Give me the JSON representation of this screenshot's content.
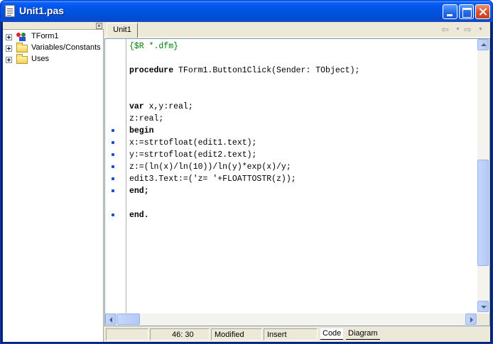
{
  "window": {
    "title": "Unit1.pas"
  },
  "tree": {
    "items": [
      {
        "label": "TForm1",
        "icon": "component-icon"
      },
      {
        "label": "Variables/Constants",
        "icon": "folder-icon"
      },
      {
        "label": "Uses",
        "icon": "folder-icon"
      }
    ],
    "close_label": "×"
  },
  "editor": {
    "tabs": [
      {
        "label": "Unit1"
      }
    ],
    "code_lines": [
      {
        "text": "{$R *.dfm}",
        "style": "comment",
        "dot": false
      },
      {
        "text": "",
        "style": "",
        "dot": false
      },
      {
        "text": "procedure TForm1.Button1Click(Sender: TObject);",
        "style": "",
        "dot": false,
        "keyword": "procedure"
      },
      {
        "text": "",
        "style": "",
        "dot": false
      },
      {
        "text": "",
        "style": "",
        "dot": false
      },
      {
        "text": "var x,y:real;",
        "style": "",
        "dot": false,
        "keyword": "var"
      },
      {
        "text": "z:real;",
        "style": "",
        "dot": false
      },
      {
        "text": "begin",
        "style": "",
        "dot": true,
        "keyword": "begin"
      },
      {
        "text": "x:=strtofloat(edit1.text);",
        "style": "",
        "dot": true
      },
      {
        "text": "y:=strtofloat(edit2.text);",
        "style": "",
        "dot": true
      },
      {
        "text": "z:=(ln(x)/ln(10))/ln(y)*exp(x)/y;",
        "style": "",
        "dot": true
      },
      {
        "text": "edit3.Text:=('z= '+FLOATTOSTR(z));",
        "style": "",
        "dot": true
      },
      {
        "text": "end;",
        "style": "",
        "dot": true,
        "keyword": "end;"
      },
      {
        "text": "",
        "style": "",
        "dot": false
      },
      {
        "text": "end.",
        "style": "",
        "dot": true,
        "keyword": "end."
      }
    ]
  },
  "status": {
    "position": "46: 30",
    "modified": "Modified",
    "mode": "Insert",
    "view_tabs": [
      "Code",
      "Diagram"
    ]
  },
  "nav": {
    "back_glyph": "⇦",
    "forward_glyph": "⇨",
    "dropdown_glyph": "▼"
  },
  "colors": {
    "comment": "#008000",
    "gutter_dot": "#1a4fd0",
    "title_bar": "#0054e3"
  }
}
